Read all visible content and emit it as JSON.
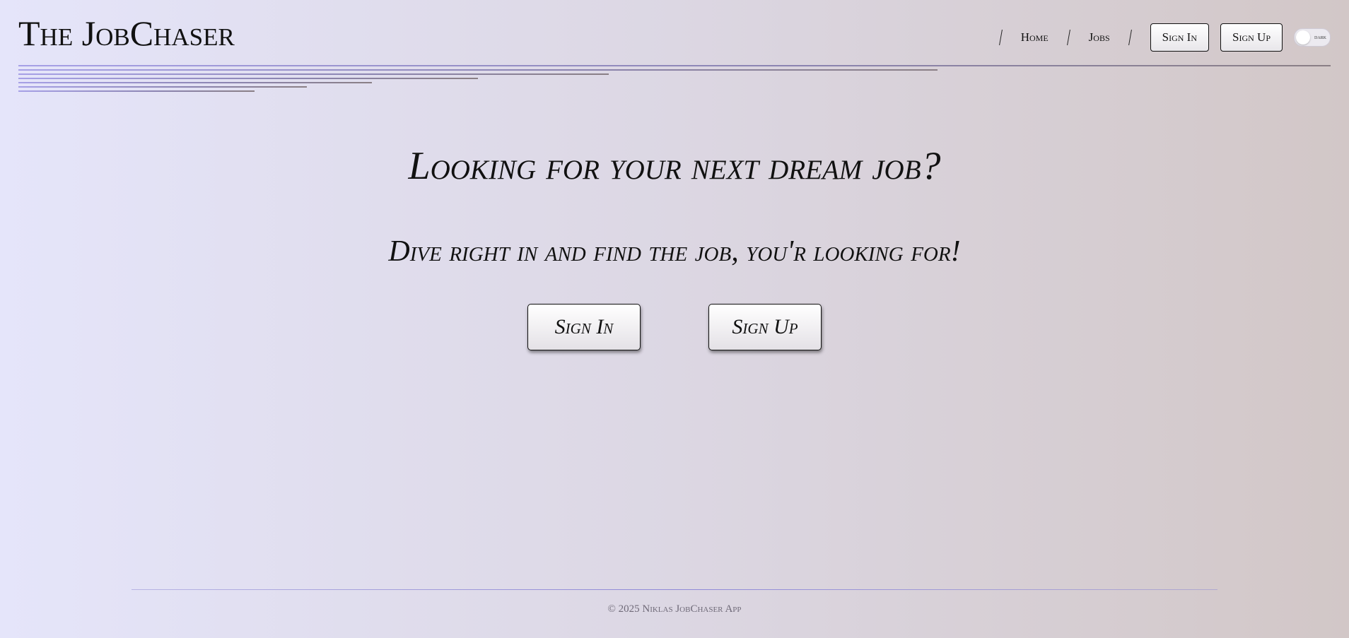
{
  "header": {
    "brand": "The JobChaser",
    "nav": {
      "home": "Home",
      "jobs": "Jobs",
      "sign_in": "Sign In",
      "sign_up": "Sign Up"
    },
    "theme_toggle": {
      "label": "dark",
      "state": "off"
    }
  },
  "hero": {
    "title": "Looking for your next dream job?",
    "subtitle": "Dive right in and find the job, you'r looking for!",
    "sign_in": "Sign In",
    "sign_up": "Sign Up"
  },
  "footer": {
    "copyright": "© 2025 Niklas JobChaser App"
  },
  "colors": {
    "background_start": "#e5e5fa",
    "background_end": "#d2c7c7",
    "accent_line": "#a6a0e6",
    "text": "#121212"
  }
}
